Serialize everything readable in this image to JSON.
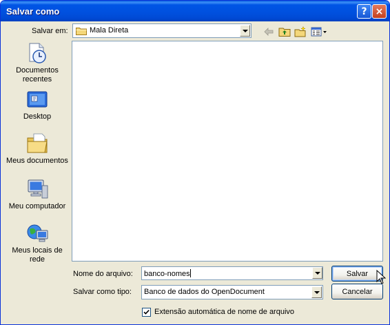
{
  "window": {
    "title": "Salvar como",
    "help_label": "?",
    "close_label": "×"
  },
  "location": {
    "label": "Salvar em:",
    "value": "Mala Direta"
  },
  "toolbar": {
    "icons": [
      "back-arrow-icon",
      "up-one-level-icon",
      "new-folder-icon",
      "view-menu-icon"
    ]
  },
  "places": [
    {
      "label": "Documentos recentes",
      "icon": "recent-documents-icon"
    },
    {
      "label": "Desktop",
      "icon": "desktop-icon"
    },
    {
      "label": "Meus documentos",
      "icon": "my-documents-icon"
    },
    {
      "label": "Meu computador",
      "icon": "my-computer-icon"
    },
    {
      "label": "Meus locais de rede",
      "icon": "network-places-icon"
    }
  ],
  "filename": {
    "label": "Nome do arquivo:",
    "value": "banco-nomes"
  },
  "filetype": {
    "label": "Salvar como tipo:",
    "value": "Banco de dados do OpenDocument"
  },
  "buttons": {
    "save": "Salvar",
    "cancel": "Cancelar"
  },
  "auto_extension": {
    "label": "Extensão automática de nome de arquivo",
    "checked": true
  },
  "colors": {
    "titlebar": "#0054e3",
    "dialog_bg": "#ece9d8",
    "field_border": "#7f9db9"
  }
}
